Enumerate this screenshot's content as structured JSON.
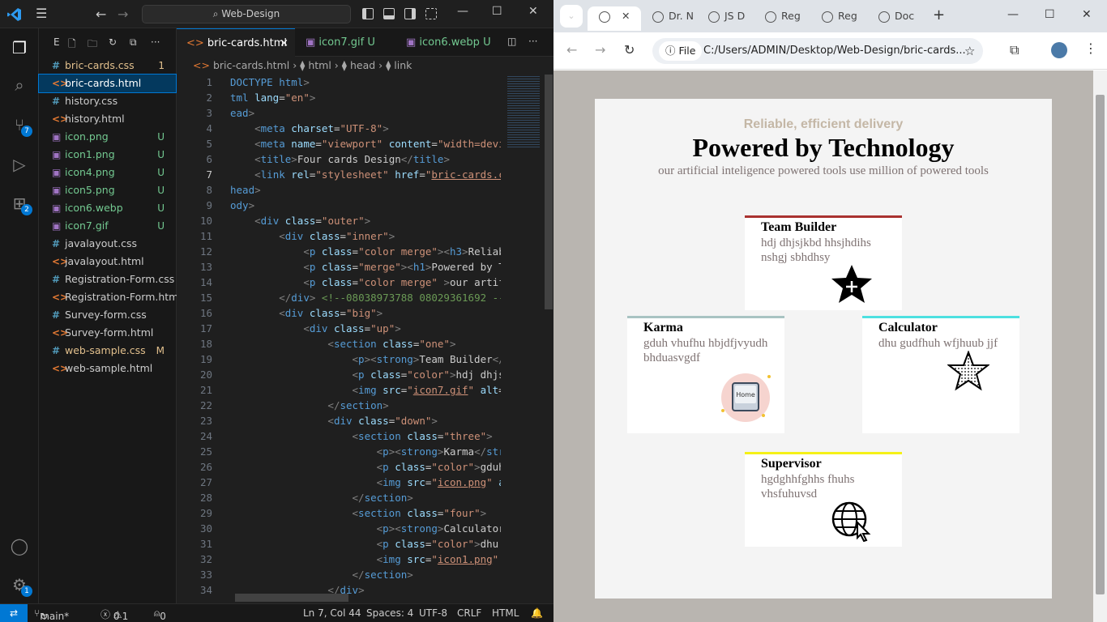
{
  "vscode": {
    "titlebar": {
      "search": "Web-Design"
    },
    "activity_badges": {
      "source_control": "7",
      "extensions": "2",
      "accounts_settings": "1"
    },
    "explorer": {
      "header": "E",
      "files": [
        {
          "icon": "#",
          "name": "bric-cards.css",
          "status": "1",
          "color": "#e2c08d"
        },
        {
          "icon": "<>",
          "name": "bric-cards.html",
          "status": "",
          "color": "#ffffff"
        },
        {
          "icon": "#",
          "name": "history.css",
          "status": "",
          "color": "#cccccc"
        },
        {
          "icon": "<>",
          "name": "history.html",
          "status": "",
          "color": "#cccccc"
        },
        {
          "icon": "▣",
          "name": "icon.png",
          "status": "U",
          "color": "#73c991"
        },
        {
          "icon": "▣",
          "name": "icon1.png",
          "status": "U",
          "color": "#73c991"
        },
        {
          "icon": "▣",
          "name": "icon4.png",
          "status": "U",
          "color": "#73c991"
        },
        {
          "icon": "▣",
          "name": "icon5.png",
          "status": "U",
          "color": "#73c991"
        },
        {
          "icon": "▣",
          "name": "icon6.webp",
          "status": "U",
          "color": "#73c991"
        },
        {
          "icon": "▣",
          "name": "icon7.gif",
          "status": "U",
          "color": "#73c991"
        },
        {
          "icon": "#",
          "name": "javalayout.css",
          "status": "",
          "color": "#cccccc"
        },
        {
          "icon": "<>",
          "name": "javalayout.html",
          "status": "",
          "color": "#cccccc"
        },
        {
          "icon": "#",
          "name": "Registration-Form.css",
          "status": "",
          "color": "#cccccc"
        },
        {
          "icon": "<>",
          "name": "Registration-Form.html",
          "status": "",
          "color": "#cccccc"
        },
        {
          "icon": "#",
          "name": "Survey-form.css",
          "status": "",
          "color": "#cccccc"
        },
        {
          "icon": "<>",
          "name": "Survey-form.html",
          "status": "",
          "color": "#cccccc"
        },
        {
          "icon": "#",
          "name": "web-sample.css",
          "status": "M",
          "color": "#e2c08d"
        },
        {
          "icon": "<>",
          "name": "web-sample.html",
          "status": "",
          "color": "#cccccc"
        }
      ]
    },
    "tabs": [
      {
        "label": "bric-cards.html",
        "status": "×"
      },
      {
        "label": "icon7.gif",
        "status": "U"
      },
      {
        "label": "icon6.webp",
        "status": "U"
      }
    ],
    "breadcrumb": {
      "file": "bric-cards.html",
      "b1": "html",
      "b2": "head",
      "b3": "link"
    },
    "code_lines": [
      {
        "n": "1",
        "html": "<span class='t'>DOCTYPE html</span><span class='p'>&gt;</span>"
      },
      {
        "n": "2",
        "html": "<span class='t'>tml</span> <span class='a'>lang</span>=<span class='s'>\"en\"</span><span class='p'>&gt;</span>"
      },
      {
        "n": "3",
        "html": "<span class='t'>ead</span><span class='p'>&gt;</span>"
      },
      {
        "n": "4",
        "html": "    <span class='p'>&lt;</span><span class='t'>meta</span> <span class='a'>charset</span>=<span class='s'>\"UTF-8\"</span><span class='p'>&gt;</span>"
      },
      {
        "n": "5",
        "html": "    <span class='p'>&lt;</span><span class='t'>meta</span> <span class='a'>name</span>=<span class='s'>\"viewport\"</span> <span class='a'>content</span>=<span class='s'>\"width=devi</span>"
      },
      {
        "n": "6",
        "html": "    <span class='p'>&lt;</span><span class='t'>title</span><span class='p'>&gt;</span>Four cards Design<span class='p'>&lt;/</span><span class='t'>title</span><span class='p'>&gt;</span>"
      },
      {
        "n": "7",
        "html": "    <span class='p'>&lt;</span><span class='t'>link</span> <span class='a'>rel</span>=<span class='s'>\"stylesheet\"</span> <span class='a'>href</span>=<span class='s'>\"</span><span class='u'>bric-cards.c</span>"
      },
      {
        "n": "8",
        "html": "<span class='t'>head</span><span class='p'>&gt;</span>"
      },
      {
        "n": "9",
        "html": "<span class='t'>ody</span><span class='p'>&gt;</span>"
      },
      {
        "n": "10",
        "html": "    <span class='p'>&lt;</span><span class='t'>div</span> <span class='a'>class</span>=<span class='s'>\"outer\"</span><span class='p'>&gt;</span>"
      },
      {
        "n": "11",
        "html": "        <span class='p'>&lt;</span><span class='t'>div</span> <span class='a'>class</span>=<span class='s'>\"inner\"</span><span class='p'>&gt;</span>"
      },
      {
        "n": "12",
        "html": "            <span class='p'>&lt;</span><span class='t'>p</span> <span class='a'>class</span>=<span class='s'>\"color merge\"</span><span class='p'>&gt;&lt;</span><span class='t'>h3</span><span class='p'>&gt;</span>Reliab"
      },
      {
        "n": "13",
        "html": "            <span class='p'>&lt;</span><span class='t'>p</span> <span class='a'>class</span>=<span class='s'>\"merge\"</span><span class='p'>&gt;&lt;</span><span class='t'>h1</span><span class='p'>&gt;</span>Powered by T"
      },
      {
        "n": "14",
        "html": "            <span class='p'>&lt;</span><span class='t'>p</span> <span class='a'>class</span>=<span class='s'>\"color merge\"</span> <span class='p'>&gt;</span>our artif"
      },
      {
        "n": "15",
        "html": "        <span class='p'>&lt;/</span><span class='t'>div</span><span class='p'>&gt;</span> <span class='c'>&lt;!--08038973788 08029361692 --</span>"
      },
      {
        "n": "16",
        "html": "        <span class='p'>&lt;</span><span class='t'>div</span> <span class='a'>class</span>=<span class='s'>\"big\"</span><span class='p'>&gt;</span>"
      },
      {
        "n": "17",
        "html": "            <span class='p'>&lt;</span><span class='t'>div</span> <span class='a'>class</span>=<span class='s'>\"up\"</span><span class='p'>&gt;</span>"
      },
      {
        "n": "18",
        "html": "                <span class='p'>&lt;</span><span class='t'>section</span> <span class='a'>class</span>=<span class='s'>\"one\"</span><span class='p'>&gt;</span>"
      },
      {
        "n": "19",
        "html": "                    <span class='p'>&lt;</span><span class='t'>p</span><span class='p'>&gt;&lt;</span><span class='t'>strong</span><span class='p'>&gt;</span>Team Builder<span class='p'>&lt;/</span>"
      },
      {
        "n": "20",
        "html": "                    <span class='p'>&lt;</span><span class='t'>p</span> <span class='a'>class</span>=<span class='s'>\"color\"</span><span class='p'>&gt;</span>hdj dhjs"
      },
      {
        "n": "21",
        "html": "                    <span class='p'>&lt;</span><span class='t'>img</span> <span class='a'>src</span>=<span class='s'>\"</span><span class='u'>icon7.gif</span><span class='s'>\"</span> <span class='a'>alt</span>="
      },
      {
        "n": "22",
        "html": "                <span class='p'>&lt;/</span><span class='t'>section</span><span class='p'>&gt;</span>"
      },
      {
        "n": "23",
        "html": "                <span class='p'>&lt;</span><span class='t'>div</span> <span class='a'>class</span>=<span class='s'>\"down\"</span><span class='p'>&gt;</span>"
      },
      {
        "n": "24",
        "html": "                    <span class='p'>&lt;</span><span class='t'>section</span> <span class='a'>class</span>=<span class='s'>\"three\"</span><span class='p'>&gt;</span>"
      },
      {
        "n": "25",
        "html": "                        <span class='p'>&lt;</span><span class='t'>p</span><span class='p'>&gt;&lt;</span><span class='t'>strong</span><span class='p'>&gt;</span>Karma<span class='p'>&lt;/</span><span class='t'>str</span>"
      },
      {
        "n": "26",
        "html": "                        <span class='p'>&lt;</span><span class='t'>p</span> <span class='a'>class</span>=<span class='s'>\"color\"</span><span class='p'>&gt;</span>gduh"
      },
      {
        "n": "27",
        "html": "                        <span class='p'>&lt;</span><span class='t'>img</span> <span class='a'>src</span>=<span class='s'>\"</span><span class='u'>icon.png</span><span class='s'>\"</span> <span class='a'>a</span>"
      },
      {
        "n": "28",
        "html": "                    <span class='p'>&lt;/</span><span class='t'>section</span><span class='p'>&gt;</span>"
      },
      {
        "n": "29",
        "html": "                    <span class='p'>&lt;</span><span class='t'>section</span> <span class='a'>class</span>=<span class='s'>\"four\"</span><span class='p'>&gt;</span>"
      },
      {
        "n": "30",
        "html": "                        <span class='p'>&lt;</span><span class='t'>p</span><span class='p'>&gt;&lt;</span><span class='t'>strong</span><span class='p'>&gt;</span>Calculator"
      },
      {
        "n": "31",
        "html": "                        <span class='p'>&lt;</span><span class='t'>p</span> <span class='a'>class</span>=<span class='s'>\"color\"</span><span class='p'>&gt;</span>dhu"
      },
      {
        "n": "32",
        "html": "                        <span class='p'>&lt;</span><span class='t'>img</span> <span class='a'>src</span>=<span class='s'>\"</span><span class='u'>icon1.png</span><span class='s'>\"</span>"
      },
      {
        "n": "33",
        "html": "                    <span class='p'>&lt;/</span><span class='t'>section</span><span class='p'>&gt;</span>"
      },
      {
        "n": "34",
        "html": "                <span class='p'>&lt;/</span><span class='t'>div</span><span class='p'>&gt;</span>"
      }
    ],
    "status": {
      "branch": "main*",
      "errors": "0",
      "warnings": "1",
      "ports": "0",
      "cursor": "Ln 7, Col 44",
      "spaces": "Spaces: 4",
      "encoding": "UTF-8",
      "eol": "CRLF",
      "language": "HTML"
    }
  },
  "browser": {
    "tabs": [
      "Dr. N",
      "JS D",
      "Reg",
      "Reg",
      "Doc"
    ],
    "address_label": "File",
    "address": "C:/Users/ADMIN/Desktop/Web-Design/bric-cards...",
    "page": {
      "subtitle": "Reliable, efficient delivery",
      "title": "Powered by Technology",
      "description": "our artificial inteligence powered tools use million of powered tools",
      "cards": [
        {
          "title": "Team Builder",
          "text": "hdj dhjsjkbd hhsjhdihs nshgj sbhdhsy",
          "accent": "#a93230",
          "icon": "star-plus-icon"
        },
        {
          "title": "Karma",
          "text": "gduh vhufhu hbjdfjvyudh bhduasvgdf",
          "accent": "#a8c3c2",
          "icon": "home-key-icon"
        },
        {
          "title": "Calculator",
          "text": "dhu gudfhuh wfjhuub jjf",
          "accent": "#4de0e0",
          "icon": "dotted-star-icon"
        },
        {
          "title": "Supervisor",
          "text": "hgdghhfghhs fhuhs vhsfuhuvsd",
          "accent": "#f5f116",
          "icon": "globe-cursor-icon"
        }
      ],
      "home_key_label": "Home"
    }
  }
}
